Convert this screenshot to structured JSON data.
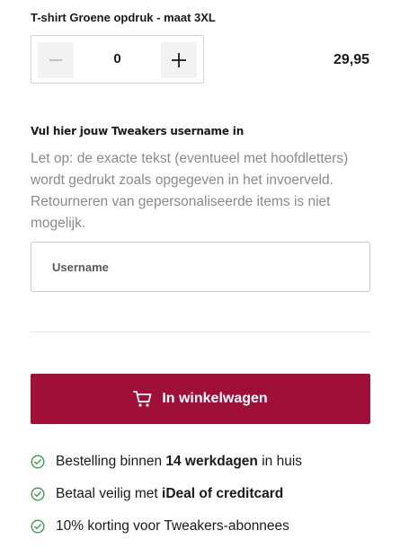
{
  "product": {
    "title": "T-shirt Groene opdruk - maat 3XL",
    "quantity": "0",
    "price": "29,95"
  },
  "personalization": {
    "label": "Vul hier jouw Tweakers username in",
    "notice": "Let op: de exacte tekst (eventueel met hoofdletters) wordt gedrukt zoals opgegeven in het invoerveld. Retourneren van gepersonaliseerde items is niet mogelijk.",
    "input_placeholder": "Username",
    "input_value": ""
  },
  "cart_button": {
    "label": "In winkelwagen",
    "icon": "shopping-cart-icon",
    "color": "#a00f37"
  },
  "usps": [
    {
      "pre": "Bestelling binnen ",
      "bold": "14 werkdagen",
      "post": " in huis",
      "icon": "check-circle-icon"
    },
    {
      "pre": "Betaal veilig met ",
      "bold": "iDeal of creditcard",
      "post": "",
      "icon": "check-circle-icon"
    },
    {
      "pre": "10% korting voor Tweakers-abonnees",
      "bold": "",
      "post": "",
      "icon": "check-circle-icon"
    }
  ],
  "colors": {
    "accent": "#a00f37",
    "check": "#3a9a4a",
    "muted_text": "#8a8a8a"
  }
}
